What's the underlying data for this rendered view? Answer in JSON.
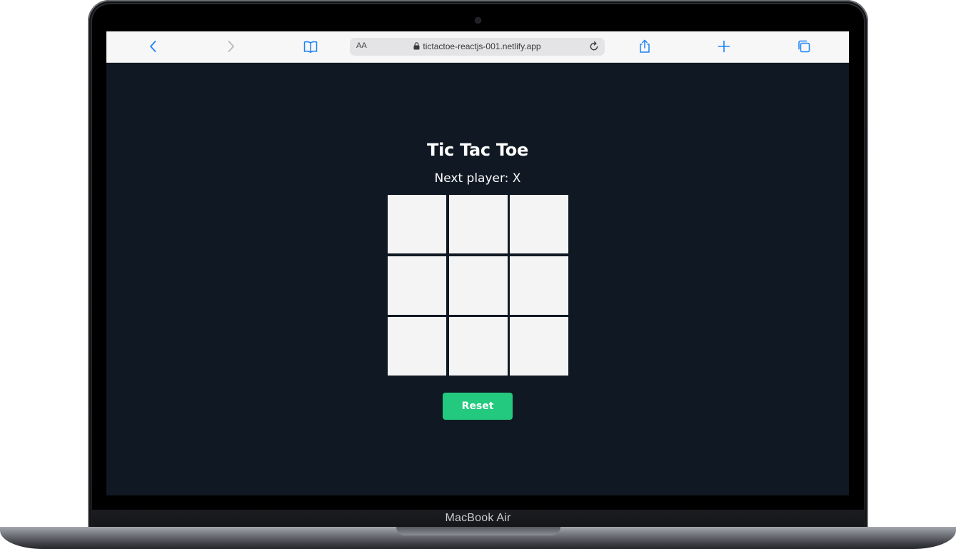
{
  "device": {
    "label": "MacBook Air"
  },
  "browser": {
    "reader_size_label": "AA",
    "url": "tictactoe-reactjs-001.netlify.app",
    "accent": "#1a82f7",
    "icons": [
      "back-icon",
      "forward-icon",
      "bookmarks-icon",
      "lock-icon",
      "reload-icon",
      "share-icon",
      "new-tab-icon",
      "tabs-icon"
    ]
  },
  "game": {
    "title": "Tic Tac Toe",
    "status": "Next player: X",
    "board": [
      "",
      "",
      "",
      "",
      "",
      "",
      "",
      "",
      ""
    ],
    "reset_label": "Reset",
    "colors": {
      "background": "#101923",
      "cell": "#f4f4f4",
      "button": "#22c97e"
    }
  }
}
